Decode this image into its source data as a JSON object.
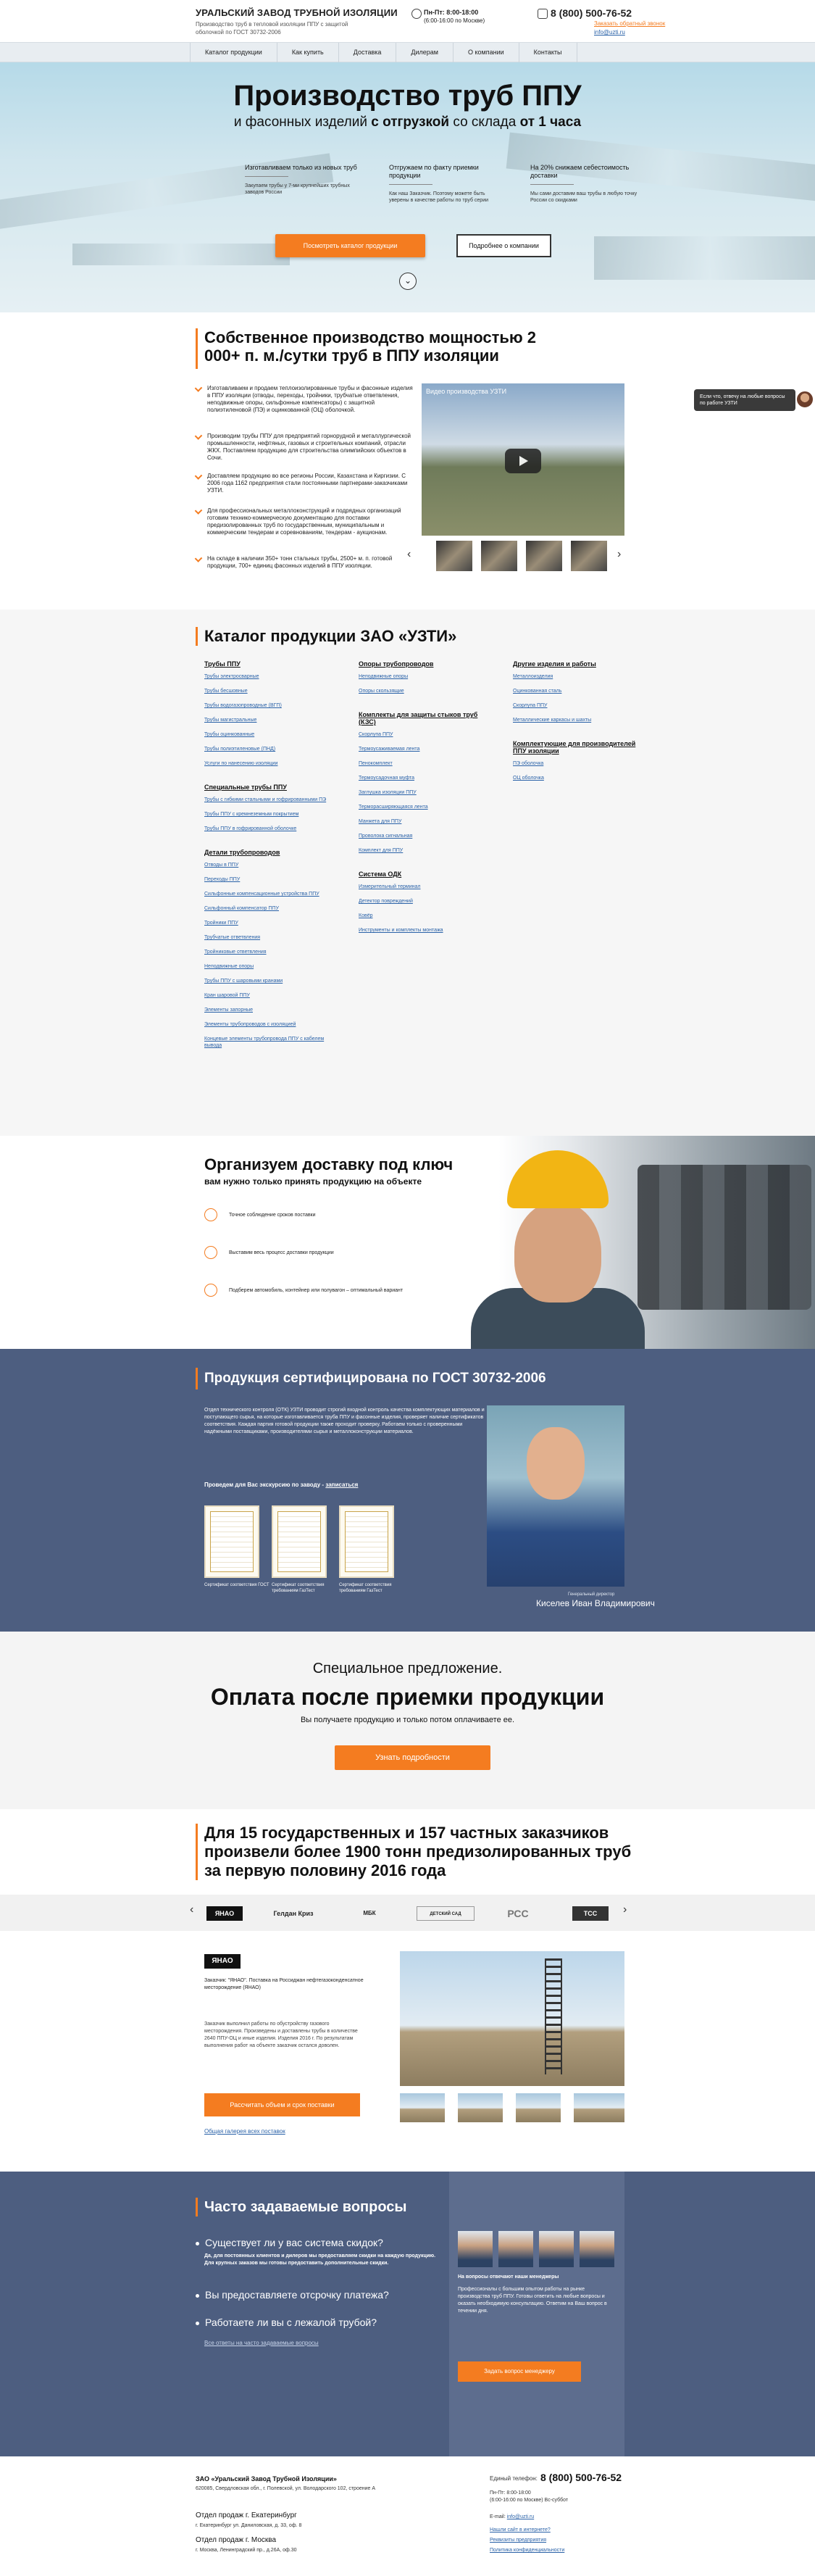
{
  "header": {
    "company": "УРАЛЬСКИЙ ЗАВОД ТРУБНОЙ ИЗОЛЯЦИИ",
    "tagline": "Производство труб в тепловой изоляции ППУ с защитой оболочкой по ГОСТ 30732-2006",
    "hours_label": "Пн-Пт: 8:00-18:00",
    "hours_note": "(6:00-16:00 по Москве)",
    "phone": "8 (800) 500-76-52",
    "callback": "Заказать обратный звонок",
    "email": "info@uzti.ru"
  },
  "nav": {
    "items": [
      "Каталог продукции",
      "Как купить",
      "Доставка",
      "Дилерам",
      "О компании",
      "Контакты"
    ]
  },
  "hero": {
    "title": "Производство труб ППУ",
    "subtitle_a": "и фасонных изделий",
    "subtitle_b": "с отгрузкой",
    "subtitle_c": "со склада",
    "subtitle_d": "от 1 часа",
    "features": [
      {
        "title": "Изготавливаем только из новых труб",
        "desc": "Закупаем трубы у 7-ми крупнейших трубных заводов России"
      },
      {
        "title": "Отгружаем по факту приемки продукции",
        "desc": "Как наш Заказчик. Поэтому можете быть уверены в качестве работы по труб серии"
      },
      {
        "title": "На 20% снижаем себестоимость доставки",
        "desc": "Мы сами доставим ваш трубы в любую точку России со скидками"
      }
    ],
    "cta_primary": "Посмотреть каталог продукции",
    "cta_secondary": "Подробнее о компании",
    "scroll_icon": "chevron-down"
  },
  "chat": {
    "text": "Если что, отвечу на любые вопросы по работе УЗТИ"
  },
  "production": {
    "title": "Собственное производство мощностью 2 000+ п. м./сутки труб в ППУ изоляции",
    "items": [
      "Изготавливаем и продаем теплоизолированные трубы и фасонные изделия в ППУ изоляции (отводы, переходы, тройники, трубчатые ответвления, неподвижные опоры, сильфонные компенсаторы) с защитной полиэтиленовой (ПЭ) и оцинкованной (ОЦ) оболочкой.",
      "Производим трубы ППУ для предприятий горнорудной и металлургической промышленности, нефтяных, газовых и строительных компаний, отрасли ЖКХ. Поставляем продукцию для строительства олимпийских объектов в Сочи.",
      "Доставляем продукцию во все регионы России, Казахстана и Киргизии. С 2006 года 1162 предприятия стали постоянными партнерами-заказчиками УЗТИ.",
      "Для профессиональных металлоконструкций и подрядных организаций готовим технико-коммерческую документацию для поставки предизолированных труб по государственным, муниципальным и коммерческим тендерам и соревнованиям, тендерам - аукционам.",
      "На складе в наличии 350+ тонн стальных трубы, 2500+ м. п. готовой продукции, 700+ единиц фасонных изделий в ППУ изоляции."
    ],
    "video_title": "Видео производства УЗТИ",
    "video_icon": "play-icon"
  },
  "catalog": {
    "title": "Каталог продукции ЗАО «УЗТИ»",
    "col1": [
      {
        "h": "Трубы ППУ",
        "links": [
          "Трубы электросварные",
          "Трубы бесшовные",
          "Трубы водогазопроводные (ВГП)",
          "Трубы магистральные",
          "Трубы оцинкованные",
          "Трубы полиэтиленовые (ПНД)",
          "Услуги по нанесению изоляции"
        ]
      },
      {
        "h": "Специальные трубы ППУ",
        "links": [
          "Трубы с гибкими стальными и гофрированными ПЭ",
          "Трубы ППУ с кремнеземным покрытием",
          "Трубы ППУ в гофрированной оболочке"
        ]
      },
      {
        "h": "Детали трубопроводов",
        "links": [
          "Отводы в ППУ",
          "Переходы ППУ",
          "Сильфонные компенсационные устройства ППУ",
          "Сильфонный компенсатор ППУ",
          "Тройники ППУ",
          "Трубчатые ответвления",
          "Тройниковые ответвления",
          "Неподвижные опоры",
          "Трубы ППУ с шаровыми кранами",
          "Кран шаровой ППУ",
          "Элементы запорные",
          "Элементы трубопроводов с изоляцией",
          "Концевые элементы трубопровода ППУ с кабелем вывода"
        ]
      }
    ],
    "col2": [
      {
        "h": "Опоры трубопроводов",
        "links": [
          "Неподвижные опоры",
          "Опоры скользящие"
        ]
      },
      {
        "h": "Комплекты для защиты стыков труб (КЗС)",
        "links": [
          "Скорлупа ППУ",
          "Термоусаживаемая лента",
          "Пенокомплект",
          "Термоусадочная муфта",
          "Заглушка изоляции ППУ",
          "Терморасширяющаяся лента",
          "Манжета для ППУ",
          "Проволока сигнальная",
          "Комплект для ППУ"
        ]
      },
      {
        "h": "Система ОДК",
        "links": [
          "Измерительный терминал",
          "Детектор повреждений",
          "Ковёр",
          "Инструменты и комплекты монтажа"
        ]
      }
    ],
    "col3": [
      {
        "h": "Другие изделия и работы",
        "links": [
          "Металлоизделия",
          "Оцинкованная сталь",
          "Скорлупа ППУ",
          "Металлические каркасы и шахты"
        ]
      },
      {
        "h": "Комплектующие для производителей ППУ изоляции",
        "links": [
          "ПЭ оболочка",
          "ОЦ оболочка"
        ]
      }
    ]
  },
  "delivery": {
    "title": "Организуем доставку под ключ",
    "subtitle": "вам нужно только принять продукцию на объекте",
    "items": [
      "Точное соблюдение сроков поставки",
      "Выставим весь процесс доставки продукции",
      "Подберем автомобиль, контейнер или полувагон – оптимальный вариант"
    ]
  },
  "cert": {
    "title": "Продукция сертифицирована по ГОСТ 30732-2006",
    "text": "Отдел технического контроля (ОТК) УЗТИ проводит строгий входной контроль качества комплектующих материалов и поступающего сырья, на которые изготавливается труба ППУ и фасонные изделия, проверяет наличие сертификатов соответствия. Каждая партия готовой продукции также проходит проверку. Работаем только с проверенными надёжными поставщиками, производителями сырья и металлоконструкции материалов.",
    "cta_a": "Проведем для Вас экскурсию по заводу -",
    "cta_b": "записаться",
    "certs": [
      "Сертификат соответствия ГОСТ",
      "Сертификат соответствия требованиям ГазТест",
      "Сертификат соответствия требованиям ГазТест"
    ],
    "director_title": "Генеральный директор",
    "director_name": "Киселев Иван Владимирович"
  },
  "offer": {
    "line1": "Специальное предложение.",
    "line2": "Оплата после приемки продукции",
    "line3": "Вы получаете продукцию и только потом оплачиваете ее.",
    "button": "Узнать подробности"
  },
  "clients": {
    "title": "Для 15 государственных и 157 частных заказчиков произвели более 1900 тонн предизолированных труб за первую половину 2016 года",
    "logos": [
      "ЯНАО",
      "Гелдан Криз",
      "МБК",
      "ДЕТСКИЙ САД",
      "РСС",
      "ТСС"
    ],
    "case_logo": "ЯНАО",
    "case_text": "Заказчик: \"ЯНАО\". Поставка на Россиджан нефтегазоконденсатное месторождение (ЯНАО)",
    "case_text2": "Заказчик выполнил работы по обустройству газового месторождения. Произведены и доставлены трубы в количестве 2640 ППУ-ОЦ и иные изделия. Изделия 2016 г. По результатам выполнения работ на объекте заказчик остался доволен.",
    "button": "Рассчитать объем и срок поставки",
    "link": "Общая галерея всех поставок"
  },
  "faq": {
    "title": "Часто задаваемые вопросы",
    "q1": "Существует ли у вас система скидок?",
    "a1": "Да, для постоянных клиентов и дилеров мы предоставляем скидки на каждую продукцию. Для крупных заказов мы готовы предоставить дополнительные скидки.",
    "q2": "Вы предоставляете отсрочку платежа?",
    "q3": "Работаете ли вы с лежалой трубой?",
    "all": "Все ответы на часто задаваемые вопросы",
    "panel_title": "На вопросы отвечают наши менеджеры",
    "panel_text": "Профессионалы с большим опытом работы на рынке производства труб ППУ. Готовы ответить на любые вопросы и оказать необходимую консультацию. Ответим на Ваш вопрос в течении дня.",
    "panel_button": "Задать вопрос менеджеру"
  },
  "footer": {
    "company": "ЗАО «Уральский Завод Трубной Изоляции»",
    "address": "620085, Свердловская обл., г. Полевской, ул. Володарского 102, строение А",
    "office1_title": "Отдел продаж г. Екатеринбург",
    "office1_addr": "г. Екатеринбург ул. Даниловская, д. 33, оф. 8",
    "office2_title": "Отдел продаж г. Москва",
    "office2_addr": "г. Москва, Ленинградский пр., д.26А, оф.30",
    "phone_label": "Единый телефон:",
    "phone": "8 (800) 500-76-52",
    "hours": "Пн-Пт: 8:00-18:00",
    "hours_note": "(6:00-16:00 по Москве) Вс-суббот",
    "email_label": "E-mail:",
    "email": "info@uzti.ru",
    "links": [
      "Нашли сайт в интернете?",
      "Реквизиты предприятия",
      "Политика конфиденциальности"
    ]
  }
}
